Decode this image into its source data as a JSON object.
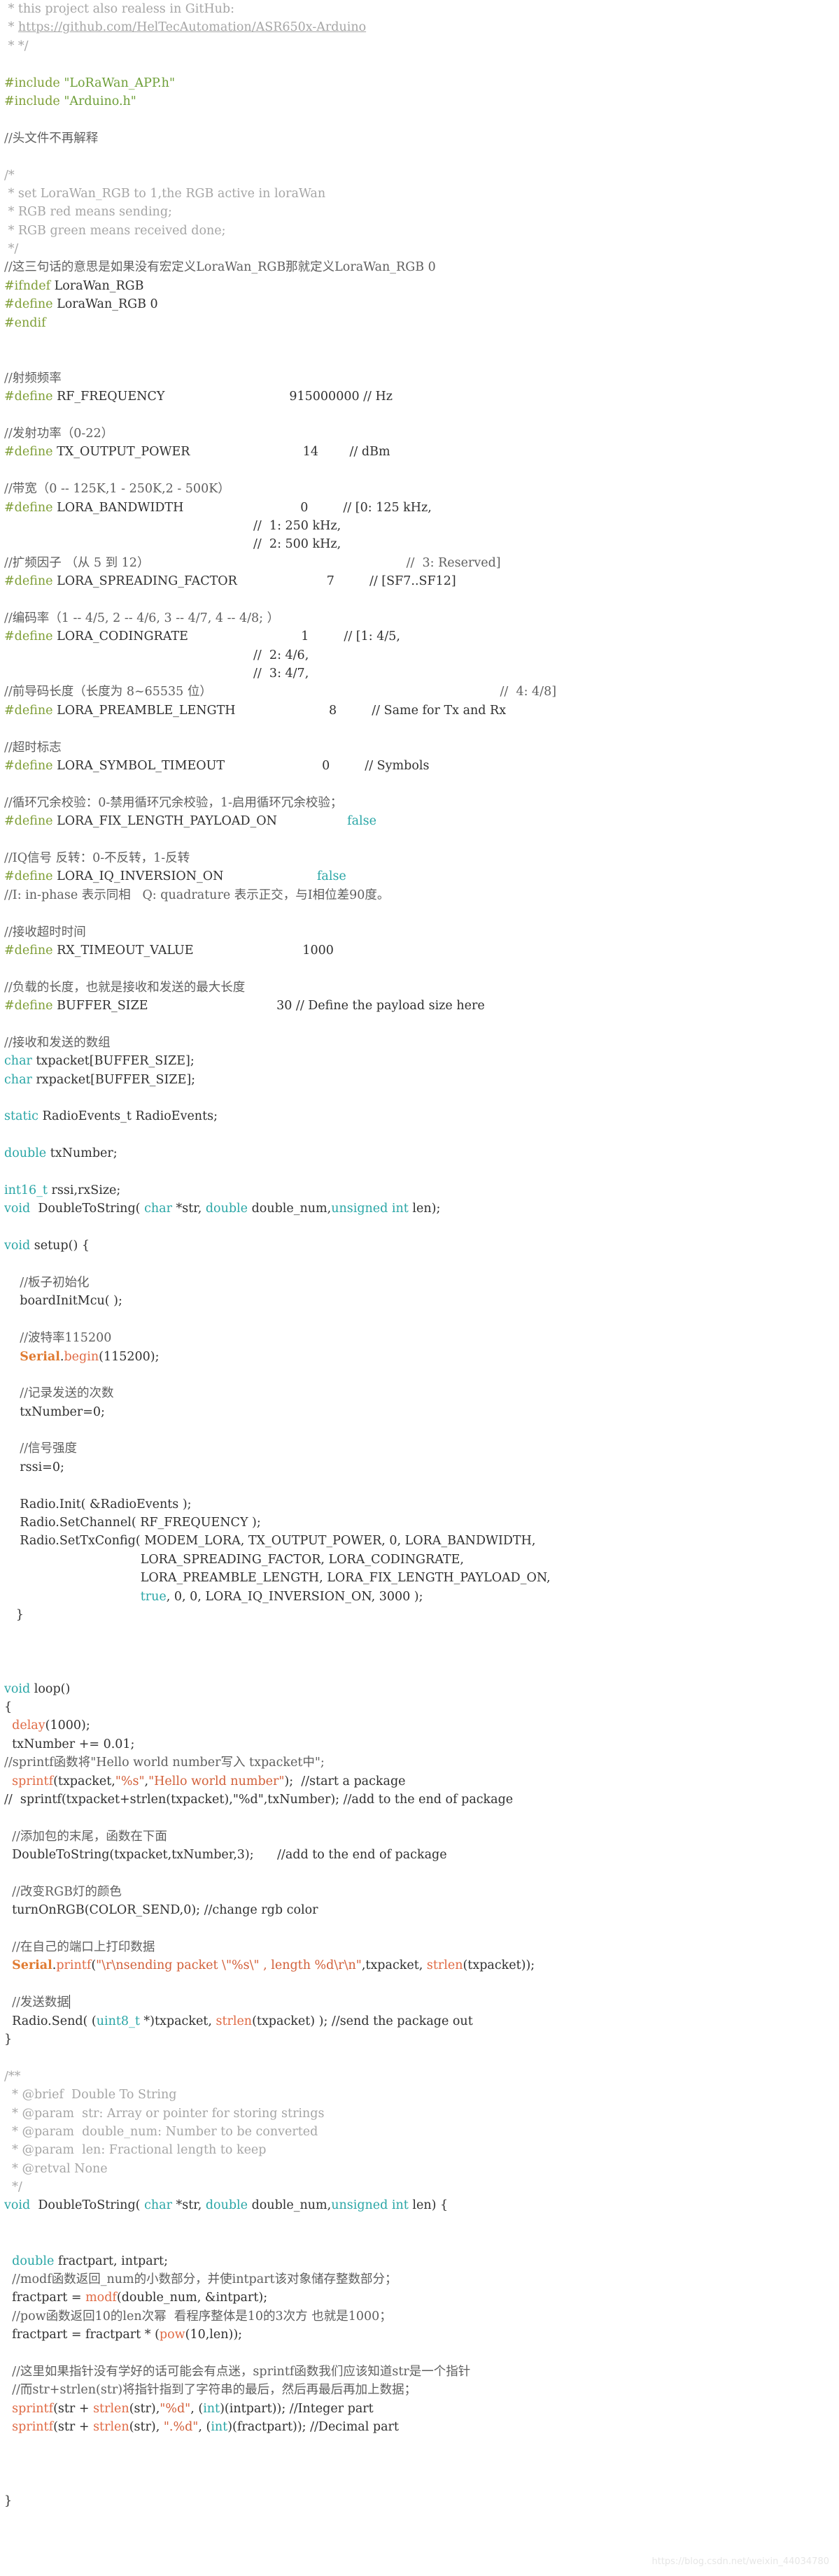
{
  "lines": [
    [
      {
        "t": " * this project also realess in GitHub:",
        "c": "cmt"
      }
    ],
    [
      {
        "t": " * ",
        "c": "cmt"
      },
      {
        "t": "https://github.com/HelTecAutomation/ASR650x-Arduino",
        "c": "link"
      }
    ],
    [
      {
        "t": " * */",
        "c": "cmt"
      }
    ],
    [],
    [
      {
        "t": "#include ",
        "c": "kw"
      },
      {
        "t": "\"LoRaWan_APP.h\"",
        "c": "str"
      }
    ],
    [
      {
        "t": "#include ",
        "c": "kw"
      },
      {
        "t": "\"Arduino.h\"",
        "c": "str"
      }
    ],
    [],
    [
      {
        "t": "//头文件不再解释",
        "c": "cmt-dark"
      }
    ],
    [],
    [
      {
        "t": "/*",
        "c": "cmt"
      }
    ],
    [
      {
        "t": " * set LoraWan_RGB to 1,the RGB active in loraWan",
        "c": "cmt"
      }
    ],
    [
      {
        "t": " * RGB red means sending;",
        "c": "cmt"
      }
    ],
    [
      {
        "t": " * RGB green means received done;",
        "c": "cmt"
      }
    ],
    [
      {
        "t": " */",
        "c": "cmt"
      }
    ],
    [
      {
        "t": "//这三句话的意思是如果没有宏定义LoraWan_RGB那就定义LoraWan_RGB 0",
        "c": "cmt-dark"
      }
    ],
    [
      {
        "t": "#ifndef ",
        "c": "kw"
      },
      {
        "t": "LoraWan_RGB"
      }
    ],
    [
      {
        "t": "#define ",
        "c": "kw"
      },
      {
        "t": "LoraWan_RGB 0"
      }
    ],
    [
      {
        "t": "#endif",
        "c": "kw"
      }
    ],
    [],
    [],
    [
      {
        "t": "//射频频率",
        "c": "cmt-dark"
      }
    ],
    [
      {
        "t": "#define ",
        "c": "kw"
      },
      {
        "t": "RF_FREQUENCY                                915000000 // Hz"
      }
    ],
    [],
    [
      {
        "t": "//发射功率（0-22）",
        "c": "cmt-dark"
      }
    ],
    [
      {
        "t": "#define ",
        "c": "kw"
      },
      {
        "t": "TX_OUTPUT_POWER                             14        // dBm"
      }
    ],
    [],
    [
      {
        "t": "//带宽（0 -- 125K,1 - 250K,2 - 500K）",
        "c": "cmt-dark"
      }
    ],
    [
      {
        "t": "#define ",
        "c": "kw"
      },
      {
        "t": "LORA_BANDWIDTH                              0         // [0: 125 kHz,"
      }
    ],
    [
      {
        "t": "                                                                //  1: 250 kHz,"
      }
    ],
    [
      {
        "t": "                                                                //  2: 500 kHz,"
      }
    ],
    [
      {
        "t": "//扩频因子 （从 5 到 12）                                                                  //  3: Reserved]",
        "c": "cmt-dark"
      }
    ],
    [
      {
        "t": "#define ",
        "c": "kw"
      },
      {
        "t": "LORA_SPREADING_FACTOR                       7         // [SF7..SF12]"
      }
    ],
    [],
    [
      {
        "t": "//编码率（1 -- 4/5, 2 -- 4/6, 3 -- 4/7, 4 -- 4/8; ）",
        "c": "cmt-dark"
      }
    ],
    [
      {
        "t": "#define ",
        "c": "kw"
      },
      {
        "t": "LORA_CODINGRATE                             1         // [1: 4/5,"
      }
    ],
    [
      {
        "t": "                                                                //  2: 4/6,"
      }
    ],
    [
      {
        "t": "                                                                //  3: 4/7,"
      }
    ],
    [
      {
        "t": "//前导码长度（长度为 8~65535 位）                                                                          //  4: 4/8]",
        "c": "cmt-dark"
      }
    ],
    [
      {
        "t": "#define ",
        "c": "kw"
      },
      {
        "t": "LORA_PREAMBLE_LENGTH                        8         // Same for Tx and Rx"
      }
    ],
    [],
    [
      {
        "t": "//超时标志",
        "c": "cmt-dark"
      }
    ],
    [
      {
        "t": "#define ",
        "c": "kw"
      },
      {
        "t": "LORA_SYMBOL_TIMEOUT                         0         // Symbols"
      }
    ],
    [],
    [
      {
        "t": "//循环冗余校验：0-禁用循环冗余校验，1-启用循环冗余校验；",
        "c": "cmt-dark"
      }
    ],
    [
      {
        "t": "#define ",
        "c": "kw"
      },
      {
        "t": "LORA_FIX_LENGTH_PAYLOAD_ON                  "
      },
      {
        "t": "false",
        "c": "bool"
      }
    ],
    [],
    [
      {
        "t": "//IQ信号 反转：0-不反转，1-反转",
        "c": "cmt-dark"
      }
    ],
    [
      {
        "t": "#define ",
        "c": "kw"
      },
      {
        "t": "LORA_IQ_INVERSION_ON                        "
      },
      {
        "t": "false",
        "c": "bool"
      }
    ],
    [
      {
        "t": "//I: in-phase 表示同相   Q: quadrature 表示正交，与I相位差90度。",
        "c": "cmt-dark"
      }
    ],
    [],
    [
      {
        "t": "//接收超时时间",
        "c": "cmt-dark"
      }
    ],
    [
      {
        "t": "#define ",
        "c": "kw"
      },
      {
        "t": "RX_TIMEOUT_VALUE                            1000"
      }
    ],
    [],
    [
      {
        "t": "//负载的长度，也就是接收和发送的最大长度",
        "c": "cmt-dark"
      }
    ],
    [
      {
        "t": "#define ",
        "c": "kw"
      },
      {
        "t": "BUFFER_SIZE                                 30 // Define the payload size here"
      }
    ],
    [],
    [
      {
        "t": "//接收和发送的数组",
        "c": "cmt-dark"
      }
    ],
    [
      {
        "t": "char ",
        "c": "type"
      },
      {
        "t": "txpacket[BUFFER_SIZE];"
      }
    ],
    [
      {
        "t": "char ",
        "c": "type"
      },
      {
        "t": "rxpacket[BUFFER_SIZE];"
      }
    ],
    [],
    [
      {
        "t": "static ",
        "c": "type"
      },
      {
        "t": "RadioEvents_t RadioEvents;"
      }
    ],
    [],
    [
      {
        "t": "double ",
        "c": "type"
      },
      {
        "t": "txNumber;"
      }
    ],
    [],
    [
      {
        "t": "int16_t ",
        "c": "type"
      },
      {
        "t": "rssi,rxSize;"
      }
    ],
    [
      {
        "t": "void ",
        "c": "type"
      },
      {
        "t": " DoubleToString( "
      },
      {
        "t": "char ",
        "c": "type"
      },
      {
        "t": "*str, "
      },
      {
        "t": "double ",
        "c": "type"
      },
      {
        "t": "double_num,"
      },
      {
        "t": "unsigned int ",
        "c": "type"
      },
      {
        "t": "len);"
      }
    ],
    [],
    [
      {
        "t": "void ",
        "c": "type"
      },
      {
        "t": "setup() {"
      }
    ],
    [],
    [
      {
        "t": "    //板子初始化",
        "c": "cmt-dark"
      }
    ],
    [
      {
        "t": "    boardInitMcu( );"
      }
    ],
    [],
    [
      {
        "t": "    //波特率115200",
        "c": "cmt-dark"
      }
    ],
    [
      {
        "t": "    "
      },
      {
        "t": "Serial",
        "c": "fn-bold"
      },
      {
        "t": "."
      },
      {
        "t": "begin",
        "c": "fn"
      },
      {
        "t": "(115200);"
      }
    ],
    [],
    [
      {
        "t": "    //记录发送的次数",
        "c": "cmt-dark"
      }
    ],
    [
      {
        "t": "    txNumber=0;"
      }
    ],
    [],
    [
      {
        "t": "    //信号强度",
        "c": "cmt-dark"
      }
    ],
    [
      {
        "t": "    rssi=0;"
      }
    ],
    [],
    [
      {
        "t": "    Radio.Init( &RadioEvents );"
      }
    ],
    [
      {
        "t": "    Radio.SetChannel( RF_FREQUENCY );"
      }
    ],
    [
      {
        "t": "    Radio.SetTxConfig( MODEM_LORA, TX_OUTPUT_POWER, 0, LORA_BANDWIDTH,"
      }
    ],
    [
      {
        "t": "                                   LORA_SPREADING_FACTOR, LORA_CODINGRATE,"
      }
    ],
    [
      {
        "t": "                                   LORA_PREAMBLE_LENGTH, LORA_FIX_LENGTH_PAYLOAD_ON,"
      }
    ],
    [
      {
        "t": "                                   "
      },
      {
        "t": "true",
        "c": "bool"
      },
      {
        "t": ", 0, 0, LORA_IQ_INVERSION_ON, 3000 );"
      }
    ],
    [
      {
        "t": "   }"
      }
    ],
    [],
    [],
    [],
    [
      {
        "t": "void ",
        "c": "type"
      },
      {
        "t": "loop()"
      }
    ],
    [
      {
        "t": "{"
      }
    ],
    [
      {
        "t": "  "
      },
      {
        "t": "delay",
        "c": "fn"
      },
      {
        "t": "(1000);"
      }
    ],
    [
      {
        "t": "  txNumber += 0.01;"
      }
    ],
    [
      {
        "t": "//sprintf函数将\"Hello world number写入 txpacket中\";",
        "c": "cmt-dark"
      }
    ],
    [
      {
        "t": "  "
      },
      {
        "t": "sprintf",
        "c": "fn"
      },
      {
        "t": "(txpacket,"
      },
      {
        "t": "\"%s\"",
        "c": "str-red"
      },
      {
        "t": ","
      },
      {
        "t": "\"Hello world number\"",
        "c": "str-red"
      },
      {
        "t": ");  //start a package"
      }
    ],
    [
      {
        "t": "//  sprintf(txpacket+strlen(txpacket),\"%d\",txNumber); //add to the end of package"
      }
    ],
    [],
    [
      {
        "t": "  //添加包的末尾，函数在下面",
        "c": "cmt-dark"
      }
    ],
    [
      {
        "t": "  DoubleToString(txpacket,txNumber,3);      //add to the end of package"
      }
    ],
    [],
    [
      {
        "t": "  //改变RGB灯的颜色",
        "c": "cmt-dark"
      }
    ],
    [
      {
        "t": "  turnOnRGB(COLOR_SEND,0); //change rgb color"
      }
    ],
    [],
    [
      {
        "t": "  //在自己的端口上打印数据",
        "c": "cmt-dark"
      }
    ],
    [
      {
        "t": "  "
      },
      {
        "t": "Serial",
        "c": "fn-bold"
      },
      {
        "t": "."
      },
      {
        "t": "printf",
        "c": "fn"
      },
      {
        "t": "("
      },
      {
        "t": "\"\\r\\nsending packet \\\"%s\\\" , length %d\\r\\n\"",
        "c": "str-red"
      },
      {
        "t": ",txpacket, "
      },
      {
        "t": "strlen",
        "c": "fn"
      },
      {
        "t": "(txpacket));"
      }
    ],
    [],
    [
      {
        "t": "  //发送数据",
        "c": "cmt-dark"
      },
      {
        "t": "",
        "c": "cursor"
      }
    ],
    [
      {
        "t": "  Radio.Send( ("
      },
      {
        "t": "uint8_t ",
        "c": "type"
      },
      {
        "t": "*)txpacket, "
      },
      {
        "t": "strlen",
        "c": "fn"
      },
      {
        "t": "(txpacket) ); //send the package out"
      }
    ],
    [
      {
        "t": "}"
      }
    ],
    [],
    [
      {
        "t": "/**",
        "c": "cmt"
      }
    ],
    [
      {
        "t": "  * @brief  Double To String",
        "c": "cmt"
      }
    ],
    [
      {
        "t": "  * @param  str: Array or pointer for storing strings",
        "c": "cmt"
      }
    ],
    [
      {
        "t": "  * @param  double_num: Number to be converted",
        "c": "cmt"
      }
    ],
    [
      {
        "t": "  * @param  len: Fractional length to keep",
        "c": "cmt"
      }
    ],
    [
      {
        "t": "  * @retval None",
        "c": "cmt"
      }
    ],
    [
      {
        "t": "  */",
        "c": "cmt"
      }
    ],
    [
      {
        "t": "void ",
        "c": "type"
      },
      {
        "t": " DoubleToString( "
      },
      {
        "t": "char ",
        "c": "type"
      },
      {
        "t": "*str, "
      },
      {
        "t": "double ",
        "c": "type"
      },
      {
        "t": "double_num,"
      },
      {
        "t": "unsigned int ",
        "c": "type"
      },
      {
        "t": "len) {"
      }
    ],
    [],
    [],
    [
      {
        "t": "  "
      },
      {
        "t": "double ",
        "c": "type"
      },
      {
        "t": "fractpart, intpart;"
      }
    ],
    [
      {
        "t": "  //modf函数返回_num的小数部分，并使intpart该对象储存整数部分；",
        "c": "cmt-dark"
      }
    ],
    [
      {
        "t": "  fractpart = "
      },
      {
        "t": "modf",
        "c": "fn"
      },
      {
        "t": "(double_num, &intpart);"
      }
    ],
    [
      {
        "t": "  //pow函数返回10的len次幂  看程序整体是10的3次方 也就是1000；",
        "c": "cmt-dark"
      }
    ],
    [
      {
        "t": "  fractpart = fractpart * ("
      },
      {
        "t": "pow",
        "c": "fn"
      },
      {
        "t": "(10,len));"
      }
    ],
    [],
    [
      {
        "t": "  //这里如果指针没有学好的话可能会有点迷，sprintf函数我们应该知道str是一个指针",
        "c": "cmt-dark"
      }
    ],
    [
      {
        "t": "  //而str+strlen(str)将指针指到了字符串的最后，然后再最后再加上数据；",
        "c": "cmt-dark"
      }
    ],
    [
      {
        "t": "  "
      },
      {
        "t": "sprintf",
        "c": "fn"
      },
      {
        "t": "(str + "
      },
      {
        "t": "strlen",
        "c": "fn"
      },
      {
        "t": "(str),"
      },
      {
        "t": "\"%d\"",
        "c": "str-red"
      },
      {
        "t": ", ("
      },
      {
        "t": "int",
        "c": "type"
      },
      {
        "t": ")(intpart)); //Integer part"
      }
    ],
    [
      {
        "t": "  "
      },
      {
        "t": "sprintf",
        "c": "fn"
      },
      {
        "t": "(str + "
      },
      {
        "t": "strlen",
        "c": "fn"
      },
      {
        "t": "(str), "
      },
      {
        "t": "\".%d\"",
        "c": "str-red"
      },
      {
        "t": ", ("
      },
      {
        "t": "int",
        "c": "type"
      },
      {
        "t": ")(fractpart)); //Decimal part"
      }
    ],
    [],
    [],
    [],
    [
      {
        "t": "}"
      }
    ]
  ],
  "watermark": "https://blog.csdn.net/weixin_44034780"
}
